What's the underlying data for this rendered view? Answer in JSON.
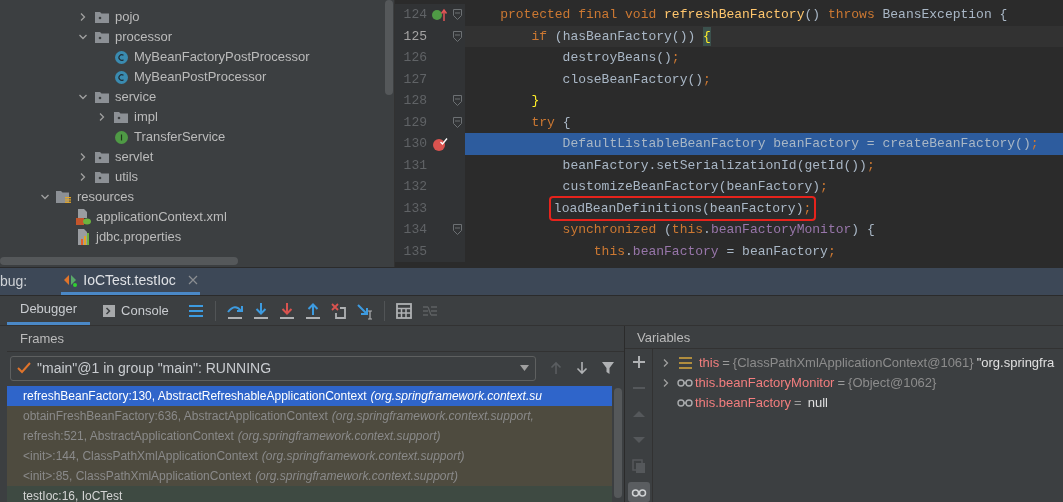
{
  "project_tree": {
    "items": [
      {
        "children": [
          {
            "children": [
              {
                "label": "pojo",
                "kind": "package",
                "expanded": false
              },
              {
                "label": "processor",
                "kind": "package",
                "expanded": true,
                "children": [
                  {
                    "label": "MyBeanFactoryPostProcessor",
                    "kind": "class"
                  },
                  {
                    "label": "MyBeanPostProcessor",
                    "kind": "class"
                  }
                ]
              },
              {
                "label": "service",
                "kind": "package",
                "expanded": true,
                "children": [
                  {
                    "label": "impl",
                    "kind": "package",
                    "expanded": false
                  },
                  {
                    "label": "TransferService",
                    "kind": "interface"
                  }
                ]
              },
              {
                "label": "servlet",
                "kind": "package",
                "expanded": false
              },
              {
                "label": "utils",
                "kind": "package",
                "expanded": false
              }
            ]
          }
        ]
      },
      {
        "label": "resources",
        "kind": "resources",
        "expanded": true,
        "children": [
          {
            "label": "applicationContext.xml",
            "kind": "xml"
          },
          {
            "label": "jdbc.properties",
            "kind": "properties"
          }
        ]
      }
    ]
  },
  "editor": {
    "lines": [
      {
        "number": "124",
        "kind": "override",
        "fold": true,
        "current": false,
        "selected": false,
        "boxed": false,
        "tokens": [
          {
            "kind": "keyword",
            "text": "    protected final void "
          },
          {
            "kind": "method",
            "text": "refreshBeanFactory"
          },
          {
            "kind": "plain",
            "text": "() "
          },
          {
            "kind": "keyword",
            "text": "throws "
          },
          {
            "kind": "plain",
            "text": "BeansException {"
          }
        ]
      },
      {
        "number": "125",
        "fold": true,
        "current": true,
        "selected": false,
        "boxed": false,
        "tokens": [
          {
            "kind": "keyword",
            "text": "        if "
          },
          {
            "kind": "plain",
            "text": "(hasBeanFactory()) "
          },
          {
            "kind": "brace",
            "text": "{"
          }
        ]
      },
      {
        "number": "126",
        "fold": false,
        "current": false,
        "selected": false,
        "boxed": false,
        "tokens": [
          {
            "kind": "plain",
            "text": "            destroyBeans()"
          },
          {
            "kind": "keyword",
            "text": ";"
          }
        ]
      },
      {
        "number": "127",
        "fold": false,
        "current": false,
        "selected": false,
        "boxed": false,
        "tokens": [
          {
            "kind": "plain",
            "text": "            closeBeanFactory()"
          },
          {
            "kind": "keyword",
            "text": ";"
          }
        ]
      },
      {
        "number": "128",
        "fold": true,
        "current": false,
        "selected": false,
        "boxed": false,
        "tokens": [
          {
            "kind": "brace",
            "text": "        }"
          }
        ]
      },
      {
        "number": "129",
        "fold": true,
        "current": false,
        "selected": false,
        "boxed": false,
        "tokens": [
          {
            "kind": "keyword",
            "text": "        try "
          },
          {
            "kind": "plain",
            "text": "{"
          }
        ]
      },
      {
        "number": "130",
        "kind": "breakpoint",
        "fold": false,
        "current": false,
        "selected": true,
        "boxed": false,
        "tokens": [
          {
            "kind": "plain",
            "text": "            DefaultListableBeanFactory beanFactory = createBeanFactory()"
          },
          {
            "kind": "keyword",
            "text": ";"
          }
        ]
      },
      {
        "number": "131",
        "fold": false,
        "current": false,
        "selected": false,
        "boxed": false,
        "tokens": [
          {
            "kind": "plain",
            "text": "            beanFactory.setSerializationId(getId())"
          },
          {
            "kind": "keyword",
            "text": ";"
          }
        ]
      },
      {
        "number": "132",
        "fold": false,
        "current": false,
        "selected": false,
        "boxed": false,
        "tokens": [
          {
            "kind": "plain",
            "text": "            customizeBeanFactory(beanFactory)"
          },
          {
            "kind": "keyword",
            "text": ";"
          }
        ]
      },
      {
        "number": "133",
        "fold": false,
        "current": false,
        "selected": false,
        "boxed": true,
        "tokens": [
          {
            "kind": "plain",
            "text": "loadBeanDefinitions(beanFactory)"
          },
          {
            "kind": "keyword",
            "text": ";"
          }
        ]
      },
      {
        "number": "134",
        "fold": true,
        "current": false,
        "selected": false,
        "boxed": false,
        "tokens": [
          {
            "kind": "keyword",
            "text": "            synchronized "
          },
          {
            "kind": "plain",
            "text": "("
          },
          {
            "kind": "keyword",
            "text": "this"
          },
          {
            "kind": "plain",
            "text": "."
          },
          {
            "kind": "field",
            "text": "beanFactoryMonitor"
          },
          {
            "kind": "plain",
            "text": ") {"
          }
        ]
      },
      {
        "number": "135",
        "fold": false,
        "current": false,
        "selected": false,
        "boxed": false,
        "tokens": [
          {
            "kind": "keyword",
            "text": "                this"
          },
          {
            "kind": "plain",
            "text": "."
          },
          {
            "kind": "field",
            "text": "beanFactory"
          },
          {
            "kind": "plain",
            "text": " = beanFactory"
          },
          {
            "kind": "keyword",
            "text": ";"
          }
        ]
      }
    ]
  },
  "debug": {
    "label": "bug:",
    "session_tab": {
      "label": "IoCTest.testIoc",
      "selected": true
    },
    "tabs": [
      {
        "label": "Debugger",
        "kind": "debugger",
        "selected": true
      },
      {
        "label": "Console",
        "kind": "console",
        "selected": false
      }
    ],
    "toolbar": [
      {
        "kind": "layout",
        "disabled": false
      },
      {
        "kind": "step-over",
        "disabled": false
      },
      {
        "kind": "step-into",
        "disabled": false
      },
      {
        "kind": "force-step-into",
        "disabled": false
      },
      {
        "kind": "step-out",
        "disabled": false
      },
      {
        "kind": "drop-frame",
        "disabled": false
      },
      {
        "kind": "run-to-cursor",
        "disabled": false
      },
      {
        "kind": "evaluate",
        "disabled": false
      },
      {
        "kind": "trace",
        "disabled": true
      }
    ],
    "frames": {
      "title": "Frames",
      "thread": "\"main\"@1 in group \"main\": RUNNING",
      "nav": [
        {
          "kind": "up",
          "disabled": true
        },
        {
          "kind": "down",
          "disabled": false
        },
        {
          "kind": "filter",
          "disabled": false
        }
      ],
      "rows": [
        {
          "location": "refreshBeanFactory:130, AbstractRefreshableApplicationContext",
          "package": "(org.springframework.context.su",
          "kind": "library",
          "selected": true
        },
        {
          "location": "obtainFreshBeanFactory:636, AbstractApplicationContext",
          "package": "(org.springframework.context.support,",
          "kind": "library",
          "selected": false
        },
        {
          "location": "refresh:521, AbstractApplicationContext",
          "package": "(org.springframework.context.support)",
          "kind": "library",
          "selected": false
        },
        {
          "location": "<init>:144, ClassPathXmlApplicationContext",
          "package": "(org.springframework.context.support)",
          "kind": "library",
          "selected": false
        },
        {
          "location": "<init>:85, ClassPathXmlApplicationContext",
          "package": "(org.springframework.context.support)",
          "kind": "library",
          "selected": false
        },
        {
          "location": "testIoc:16, IoCTest",
          "kind": "user",
          "selected": false
        }
      ]
    },
    "variables": {
      "title": "Variables",
      "side_buttons": [
        {
          "kind": "add",
          "disabled": false,
          "selected": false
        },
        {
          "kind": "remove",
          "disabled": true,
          "selected": false
        },
        {
          "kind": "up",
          "disabled": true,
          "selected": false
        },
        {
          "kind": "down",
          "disabled": true,
          "selected": false
        },
        {
          "kind": "copy",
          "disabled": true,
          "selected": false
        },
        {
          "kind": "watches",
          "disabled": false,
          "selected": true
        }
      ],
      "rows": [
        {
          "kind": "field",
          "expanded": false,
          "name": "this",
          "sign": "=",
          "value": "{ClassPathXmlApplicationContext@1061}",
          "text": "\"org.springfra"
        },
        {
          "kind": "watch",
          "expanded": false,
          "name": "this.beanFactoryMonitor",
          "sign": "=",
          "value": "{Object@1062}"
        },
        {
          "kind": "watch",
          "name": "this.beanFactory",
          "sign": "=",
          "text": "null"
        }
      ]
    }
  }
}
